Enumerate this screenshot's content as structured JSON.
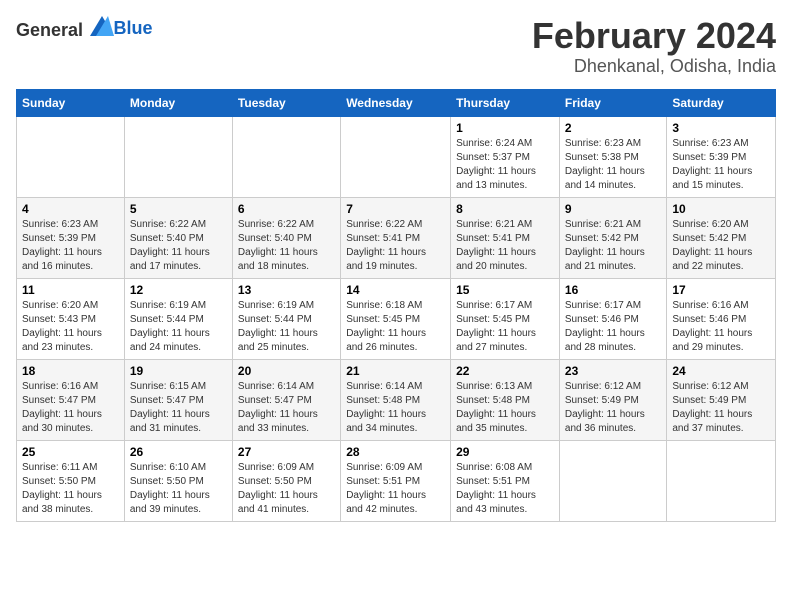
{
  "header": {
    "logo_general": "General",
    "logo_blue": "Blue",
    "title": "February 2024",
    "subtitle": "Dhenkanal, Odisha, India"
  },
  "weekdays": [
    "Sunday",
    "Monday",
    "Tuesday",
    "Wednesday",
    "Thursday",
    "Friday",
    "Saturday"
  ],
  "weeks": [
    [
      {
        "day": "",
        "details": ""
      },
      {
        "day": "",
        "details": ""
      },
      {
        "day": "",
        "details": ""
      },
      {
        "day": "",
        "details": ""
      },
      {
        "day": "1",
        "details": "Sunrise: 6:24 AM\nSunset: 5:37 PM\nDaylight: 11 hours\nand 13 minutes."
      },
      {
        "day": "2",
        "details": "Sunrise: 6:23 AM\nSunset: 5:38 PM\nDaylight: 11 hours\nand 14 minutes."
      },
      {
        "day": "3",
        "details": "Sunrise: 6:23 AM\nSunset: 5:39 PM\nDaylight: 11 hours\nand 15 minutes."
      }
    ],
    [
      {
        "day": "4",
        "details": "Sunrise: 6:23 AM\nSunset: 5:39 PM\nDaylight: 11 hours\nand 16 minutes."
      },
      {
        "day": "5",
        "details": "Sunrise: 6:22 AM\nSunset: 5:40 PM\nDaylight: 11 hours\nand 17 minutes."
      },
      {
        "day": "6",
        "details": "Sunrise: 6:22 AM\nSunset: 5:40 PM\nDaylight: 11 hours\nand 18 minutes."
      },
      {
        "day": "7",
        "details": "Sunrise: 6:22 AM\nSunset: 5:41 PM\nDaylight: 11 hours\nand 19 minutes."
      },
      {
        "day": "8",
        "details": "Sunrise: 6:21 AM\nSunset: 5:41 PM\nDaylight: 11 hours\nand 20 minutes."
      },
      {
        "day": "9",
        "details": "Sunrise: 6:21 AM\nSunset: 5:42 PM\nDaylight: 11 hours\nand 21 minutes."
      },
      {
        "day": "10",
        "details": "Sunrise: 6:20 AM\nSunset: 5:42 PM\nDaylight: 11 hours\nand 22 minutes."
      }
    ],
    [
      {
        "day": "11",
        "details": "Sunrise: 6:20 AM\nSunset: 5:43 PM\nDaylight: 11 hours\nand 23 minutes."
      },
      {
        "day": "12",
        "details": "Sunrise: 6:19 AM\nSunset: 5:44 PM\nDaylight: 11 hours\nand 24 minutes."
      },
      {
        "day": "13",
        "details": "Sunrise: 6:19 AM\nSunset: 5:44 PM\nDaylight: 11 hours\nand 25 minutes."
      },
      {
        "day": "14",
        "details": "Sunrise: 6:18 AM\nSunset: 5:45 PM\nDaylight: 11 hours\nand 26 minutes."
      },
      {
        "day": "15",
        "details": "Sunrise: 6:17 AM\nSunset: 5:45 PM\nDaylight: 11 hours\nand 27 minutes."
      },
      {
        "day": "16",
        "details": "Sunrise: 6:17 AM\nSunset: 5:46 PM\nDaylight: 11 hours\nand 28 minutes."
      },
      {
        "day": "17",
        "details": "Sunrise: 6:16 AM\nSunset: 5:46 PM\nDaylight: 11 hours\nand 29 minutes."
      }
    ],
    [
      {
        "day": "18",
        "details": "Sunrise: 6:16 AM\nSunset: 5:47 PM\nDaylight: 11 hours\nand 30 minutes."
      },
      {
        "day": "19",
        "details": "Sunrise: 6:15 AM\nSunset: 5:47 PM\nDaylight: 11 hours\nand 31 minutes."
      },
      {
        "day": "20",
        "details": "Sunrise: 6:14 AM\nSunset: 5:47 PM\nDaylight: 11 hours\nand 33 minutes."
      },
      {
        "day": "21",
        "details": "Sunrise: 6:14 AM\nSunset: 5:48 PM\nDaylight: 11 hours\nand 34 minutes."
      },
      {
        "day": "22",
        "details": "Sunrise: 6:13 AM\nSunset: 5:48 PM\nDaylight: 11 hours\nand 35 minutes."
      },
      {
        "day": "23",
        "details": "Sunrise: 6:12 AM\nSunset: 5:49 PM\nDaylight: 11 hours\nand 36 minutes."
      },
      {
        "day": "24",
        "details": "Sunrise: 6:12 AM\nSunset: 5:49 PM\nDaylight: 11 hours\nand 37 minutes."
      }
    ],
    [
      {
        "day": "25",
        "details": "Sunrise: 6:11 AM\nSunset: 5:50 PM\nDaylight: 11 hours\nand 38 minutes."
      },
      {
        "day": "26",
        "details": "Sunrise: 6:10 AM\nSunset: 5:50 PM\nDaylight: 11 hours\nand 39 minutes."
      },
      {
        "day": "27",
        "details": "Sunrise: 6:09 AM\nSunset: 5:50 PM\nDaylight: 11 hours\nand 41 minutes."
      },
      {
        "day": "28",
        "details": "Sunrise: 6:09 AM\nSunset: 5:51 PM\nDaylight: 11 hours\nand 42 minutes."
      },
      {
        "day": "29",
        "details": "Sunrise: 6:08 AM\nSunset: 5:51 PM\nDaylight: 11 hours\nand 43 minutes."
      },
      {
        "day": "",
        "details": ""
      },
      {
        "day": "",
        "details": ""
      }
    ]
  ]
}
